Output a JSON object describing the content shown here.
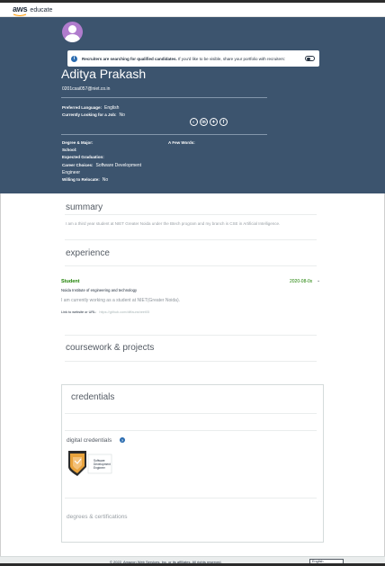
{
  "nav": {
    "logo_main": "aws",
    "logo_sub": "educate"
  },
  "profile": {
    "notice_bold": "Recruiters are searching for qualified candidates.",
    "notice_rest": " If you'd like to be visible, share your portfolio with recruiters:",
    "name": "Aditya Prakash",
    "email": "0201csai057@niet.co.in",
    "preferred_language_label": "Preferred Language:",
    "preferred_language_value": "English",
    "looking_label": "Currently Looking for a Job:",
    "looking_value": "No",
    "degree_label": "Degree & Major:",
    "few_words_label": "A Few Words:",
    "school_label": "School:",
    "graduation_label": "Expected Graduation:",
    "career_label": "Career Choices:",
    "career_value_1": "Software Development",
    "career_value_2": "Engineer",
    "relocate_label": "Willing to Relocate:",
    "relocate_value": "No",
    "socials": [
      {
        "icon": "github-icon",
        "glyph": "◐"
      },
      {
        "icon": "linkedin-icon",
        "glyph": "in"
      },
      {
        "icon": "twitter-icon",
        "glyph": "✦"
      },
      {
        "icon": "facebook-icon",
        "glyph": "f"
      }
    ]
  },
  "summary": {
    "title": "summary",
    "text": "I am a third year student at NIET Greater Noida under the Btech program and my branch is CSE in Artificial Intelligence."
  },
  "experience": {
    "title": "experience",
    "role": "Student",
    "date": "2020-08-0x",
    "org": "Noida Institute of engineering and technology",
    "description": "I am currently working as a student at NIET(Greater Noida).",
    "link_label": "Link to website or URL:",
    "link_value": "https://github.com/diffaunsheet05"
  },
  "coursework": {
    "title": "coursework & projects"
  },
  "credentials": {
    "title": "credentials",
    "digital_label": "digital credentials",
    "badge_line1": "Software",
    "badge_line2": "Development",
    "badge_line3": "Engineer",
    "degrees_label": "degrees & certifications"
  },
  "footer": {
    "copyright": "© 2022, Amazon Web Services, Inc. or its affiliates. All rights reserved.",
    "language": "English"
  },
  "colors": {
    "hero_bg": "#3c546e",
    "accent_green": "#1d8102",
    "avatar": "#b07ccd"
  }
}
